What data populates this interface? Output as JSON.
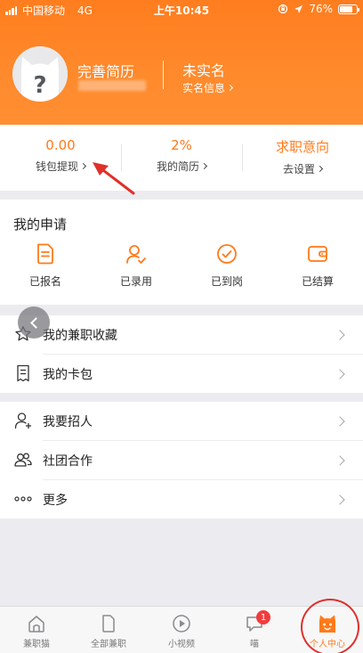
{
  "status_bar": {
    "carrier": "中国移动",
    "network": "4G",
    "time": "上午10:45",
    "battery": "76%",
    "battery_level": 0.76
  },
  "profile": {
    "title": "完善简历",
    "avatar_icon": "cat-avatar-question-icon",
    "realname_title": "未实名",
    "realname_link": "实名信息"
  },
  "stats": [
    {
      "value": "0.00",
      "label": "钱包提现"
    },
    {
      "value": "2%",
      "label": "我的简历"
    },
    {
      "value": "求职意向",
      "label": "去设置"
    }
  ],
  "applications": {
    "title": "我的申请",
    "items": [
      {
        "label": "已报名",
        "icon": "document-icon"
      },
      {
        "label": "已录用",
        "icon": "user-check-icon"
      },
      {
        "label": "已到岗",
        "icon": "check-circle-icon"
      },
      {
        "label": "已结算",
        "icon": "wallet-icon"
      }
    ]
  },
  "list_group_1": [
    {
      "label": "我的兼职收藏",
      "icon": "star-icon"
    },
    {
      "label": "我的卡包",
      "icon": "card-bag-icon"
    }
  ],
  "list_group_2": [
    {
      "label": "我要招人",
      "icon": "user-add-icon"
    },
    {
      "label": "社团合作",
      "icon": "group-icon"
    },
    {
      "label": "更多",
      "icon": "more-dots-icon"
    }
  ],
  "tabbar": [
    {
      "label": "兼职猫",
      "icon": "home-icon"
    },
    {
      "label": "全部兼职",
      "icon": "page-icon"
    },
    {
      "label": "小视频",
      "icon": "play-icon"
    },
    {
      "label": "喵",
      "icon": "chat-icon",
      "badge": "1"
    },
    {
      "label": "个人中心",
      "icon": "cat-face-icon",
      "active": true
    }
  ],
  "colors": {
    "accent": "#ff7a1a",
    "header": "#ff8a2c",
    "badge": "#f23c3c",
    "annotation": "#e0302a"
  }
}
